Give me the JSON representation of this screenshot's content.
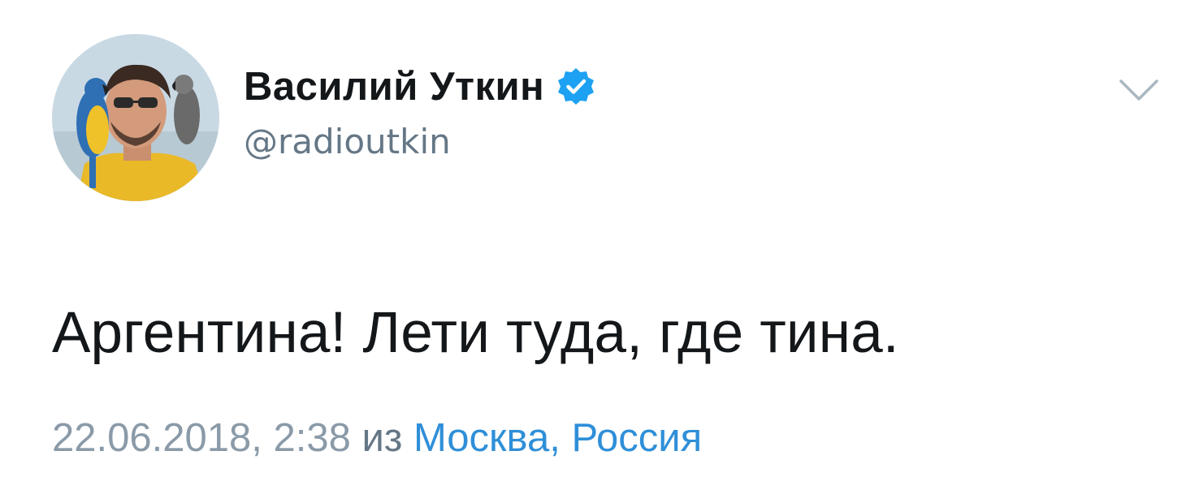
{
  "tweet": {
    "author": {
      "display_name": "Василий Уткин",
      "handle": "@radioutkin",
      "verified": true,
      "avatar": "avatar-photo"
    },
    "text": "Аргентина! Лети туда, где тина.",
    "timestamp": "22.06.2018, 2:38",
    "from_word": "из",
    "location": "Москва, Россия"
  },
  "icons": {
    "verified": "verified-badge-icon",
    "menu": "chevron-down-icon"
  },
  "colors": {
    "text_primary": "#14171a",
    "text_secondary": "#657786",
    "timestamp": "#8a9aa8",
    "link": "#2f8fd8",
    "verified": "#1da1f2"
  }
}
